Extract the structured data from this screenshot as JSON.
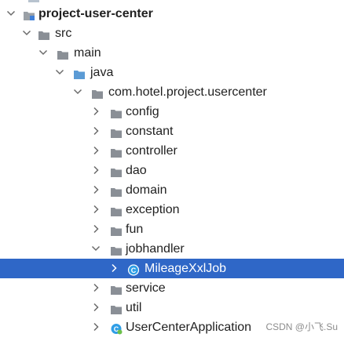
{
  "project_tree": {
    "root": {
      "label": "project-user-center",
      "icon": "module-folder-icon"
    },
    "src": {
      "label": "src"
    },
    "main": {
      "label": "main"
    },
    "java": {
      "label": "java"
    },
    "package": {
      "label": "com.hotel.project.usercenter"
    },
    "folders": [
      {
        "label": "config"
      },
      {
        "label": "constant"
      },
      {
        "label": "controller"
      },
      {
        "label": "dao"
      },
      {
        "label": "domain"
      },
      {
        "label": "exception"
      },
      {
        "label": "fun"
      },
      {
        "label": "jobhandler"
      }
    ],
    "selected_class": {
      "label": "MileageXxlJob",
      "icon": "java-class-icon"
    },
    "after_folders": [
      {
        "label": "service"
      },
      {
        "label": "util"
      }
    ],
    "app_class": {
      "label": "UserCenterApplication",
      "icon": "spring-boot-class-icon"
    }
  },
  "watermark": {
    "text": "CSDN @小飞.Su"
  },
  "colors": {
    "selection": "#2f67c7",
    "folder": "#8a8f96",
    "java_folder": "#5b9bd5",
    "class_icon": "#2f9ee6",
    "text": "#1f1f1f"
  }
}
